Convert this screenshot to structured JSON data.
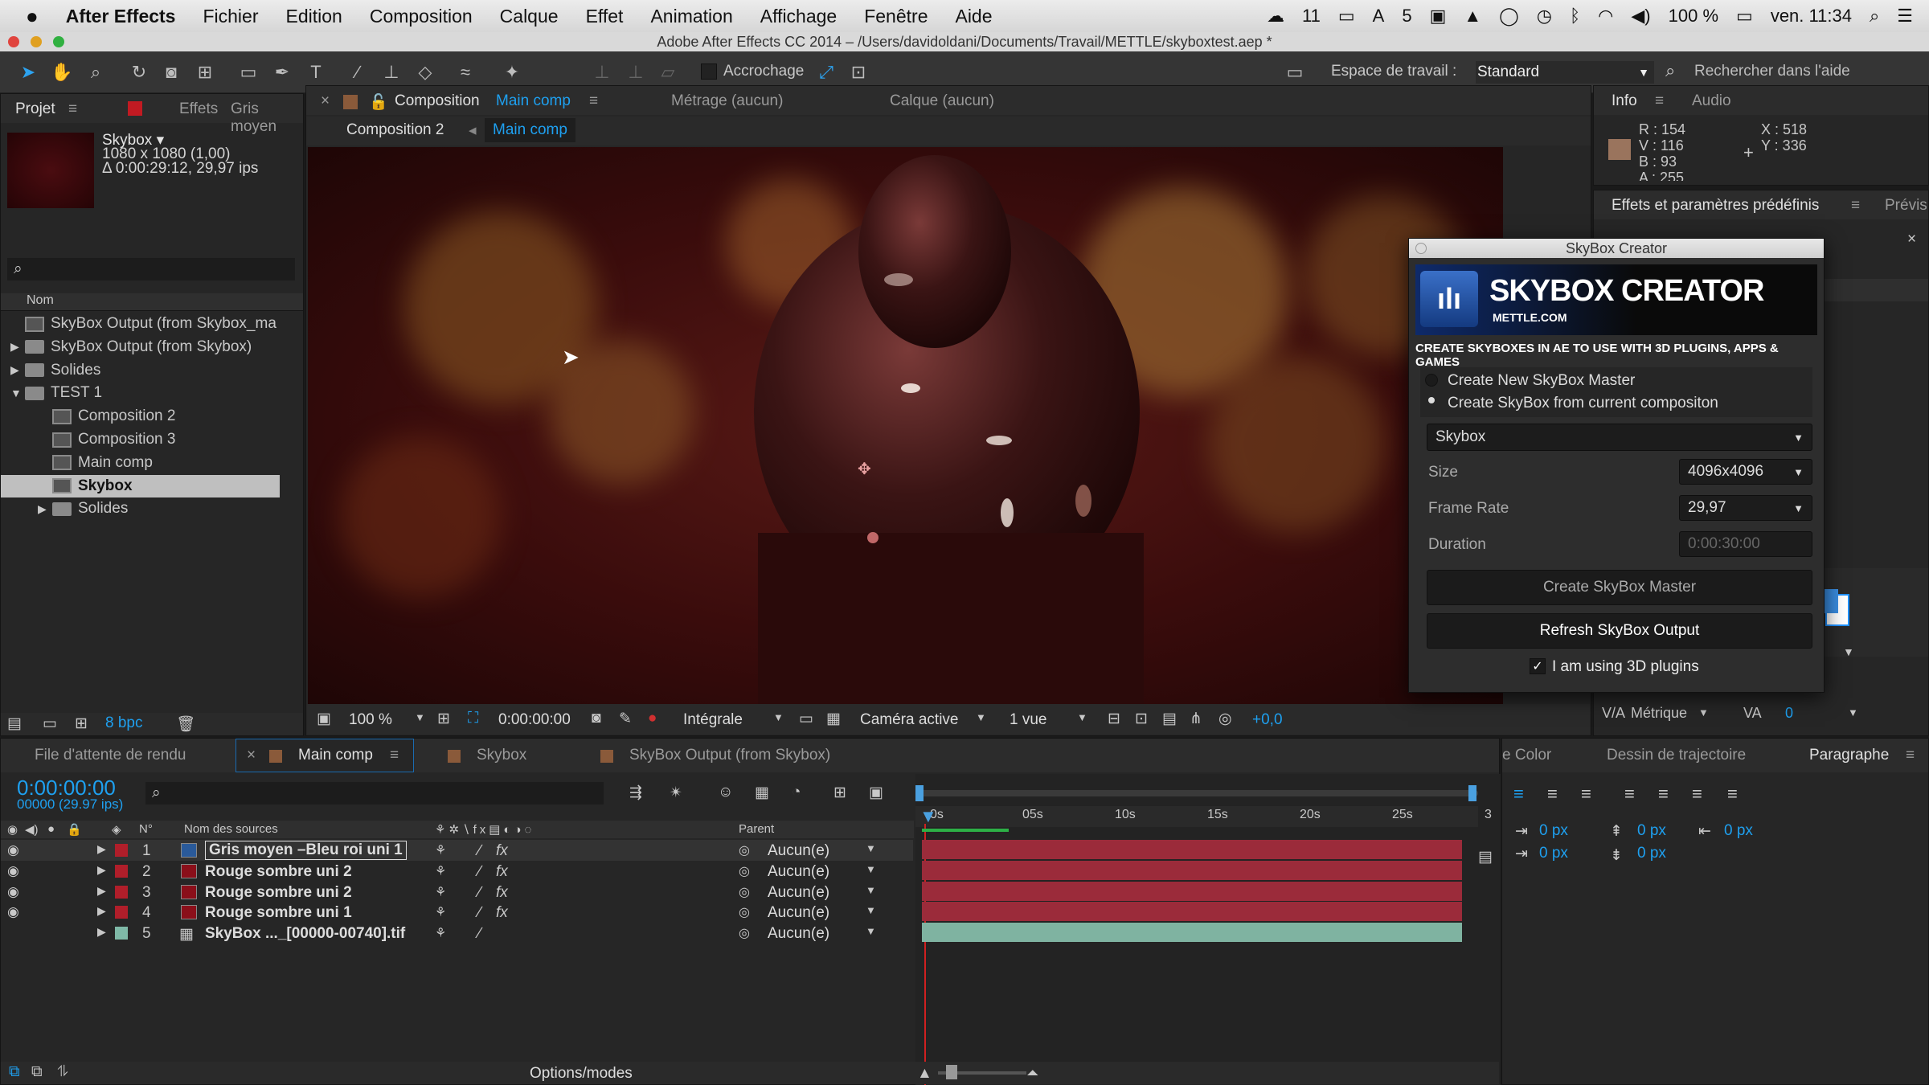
{
  "menubar": {
    "app": "After Effects",
    "items": [
      "Fichier",
      "Edition",
      "Composition",
      "Calque",
      "Effet",
      "Animation",
      "Affichage",
      "Fenêtre",
      "Aide"
    ],
    "status": {
      "cc_count": "11",
      "adobe_count": "5",
      "battery": "100 %",
      "clock": "ven. 11:34"
    }
  },
  "window": {
    "title": "Adobe After Effects CC 2014 – /Users/davidoldani/Documents/Travail/METTLE/skyboxtest.aep *"
  },
  "toolbar": {
    "snapping": "Accrochage",
    "workspace_label": "Espace de travail :",
    "workspace_value": "Standard",
    "search_placeholder": "Rechercher dans l'aide"
  },
  "project": {
    "tab": "Projet",
    "tab2": "Effets",
    "tab3": "Gris moyen",
    "item_name": "Skybox ▾",
    "item_dims": "1080 x 1080 (1,00)",
    "item_dur": "Δ 0:00:29:12, 29,97 ips",
    "col_name": "Nom",
    "bpc": "8 bpc",
    "items": [
      {
        "label": "SkyBox Output (from Skybox_ma",
        "type": "comp",
        "indent": 0,
        "arrow": ""
      },
      {
        "label": "SkyBox Output (from Skybox)",
        "type": "folder",
        "indent": 0,
        "arrow": "▶"
      },
      {
        "label": "Solides",
        "type": "folder",
        "indent": 0,
        "arrow": "▶"
      },
      {
        "label": "TEST 1",
        "type": "folder",
        "indent": 0,
        "arrow": "▼"
      },
      {
        "label": "Composition 2",
        "type": "comp",
        "indent": 1,
        "arrow": ""
      },
      {
        "label": "Composition 3",
        "type": "comp",
        "indent": 1,
        "arrow": ""
      },
      {
        "label": "Main comp",
        "type": "comp",
        "indent": 1,
        "arrow": ""
      },
      {
        "label": "Skybox",
        "type": "comp",
        "indent": 1,
        "arrow": "",
        "selected": true
      },
      {
        "label": "Solides",
        "type": "folder",
        "indent": 1,
        "arrow": "▶"
      }
    ]
  },
  "comp": {
    "tab_label": "Composition",
    "tab_name": "Main comp",
    "tab_metrage": "Métrage (aucun)",
    "tab_calque": "Calque (aucun)",
    "crumb1": "Composition 2",
    "crumb2": "Main comp",
    "zoom": "100 %",
    "timecode": "0:00:00:00",
    "resolution": "Intégrale",
    "camera": "Caméra active",
    "views": "1 vue",
    "exposure": "+0,0"
  },
  "info": {
    "tab": "Info",
    "tab2": "Audio",
    "r": "R : 154",
    "v": "V : 116",
    "b": "B : 93",
    "a": "A : 255",
    "x": "X : 518",
    "y": "Y : 336",
    "swatch": "#9a745d"
  },
  "effects": {
    "tab": "Effets et paramètres prédéfinis",
    "tab2": "Prévis"
  },
  "skybox": {
    "window_title": "SkyBox Creator",
    "brand": "SKYBOX CREATOR",
    "site": "METTLE.COM",
    "tagline": "CREATE SKYBOXES IN AE TO USE WITH 3D PLUGINS, APPS & GAMES",
    "opt1": "Create New SkyBox Master",
    "opt2": "Create SkyBox from current compositon",
    "type": "Skybox",
    "size_label": "Size",
    "size_value": "4096x4096",
    "fps_label": "Frame Rate",
    "fps_value": "29,97",
    "dur_label": "Duration",
    "dur_value": "0:00:30:00",
    "btn_master": "Create SkyBox Master",
    "btn_refresh": "Refresh SkyBox Output",
    "check_label": "I am using 3D plugins"
  },
  "timeline": {
    "tab_render": "File d'attente de rendu",
    "tab1": "Main comp",
    "tab2": "Skybox",
    "tab3": "SkyBox Output (from Skybox)",
    "timecode": "0:00:00:00",
    "frames": "00000 (29.97 ips)",
    "col_num": "N°",
    "col_name": "Nom des sources",
    "col_parent": "Parent",
    "options": "Options/modes",
    "ticks": [
      "0s",
      "05s",
      "10s",
      "15s",
      "20s",
      "25s",
      "3"
    ],
    "layers": [
      {
        "num": "1",
        "name": "Gris moyen –Bleu roi uni 1",
        "color": "#b01e2a",
        "icon": "#2a5a9a",
        "parent": "Aucun(e)",
        "bar": "#9b2b3a"
      },
      {
        "num": "2",
        "name": "Rouge sombre uni 2",
        "color": "#b01e2a",
        "icon": "#8a0f1a",
        "parent": "Aucun(e)",
        "bar": "#9b2b3a"
      },
      {
        "num": "3",
        "name": "Rouge sombre uni 2",
        "color": "#b01e2a",
        "icon": "#8a0f1a",
        "parent": "Aucun(e)",
        "bar": "#9b2b3a"
      },
      {
        "num": "4",
        "name": "Rouge sombre uni 1",
        "color": "#b01e2a",
        "icon": "#8a0f1a",
        "parent": "Aucun(e)",
        "bar": "#9b2b3a"
      },
      {
        "num": "5",
        "name": "SkyBox ..._[00000-00740].tif",
        "color": "#7fb9a7",
        "icon": "",
        "parent": "Aucun(e)",
        "bar": "#7fb3a1"
      }
    ]
  },
  "paragraph": {
    "tab_color": "e Color",
    "tab_path": "Dessin de trajectoire",
    "tab_para": "Paragraphe",
    "v1": "0 px",
    "v2": "0 px",
    "v3": "0 px",
    "v4": "0 px",
    "v5": "0 px"
  },
  "char": {
    "metric": "Métrique",
    "kerning": "0"
  }
}
